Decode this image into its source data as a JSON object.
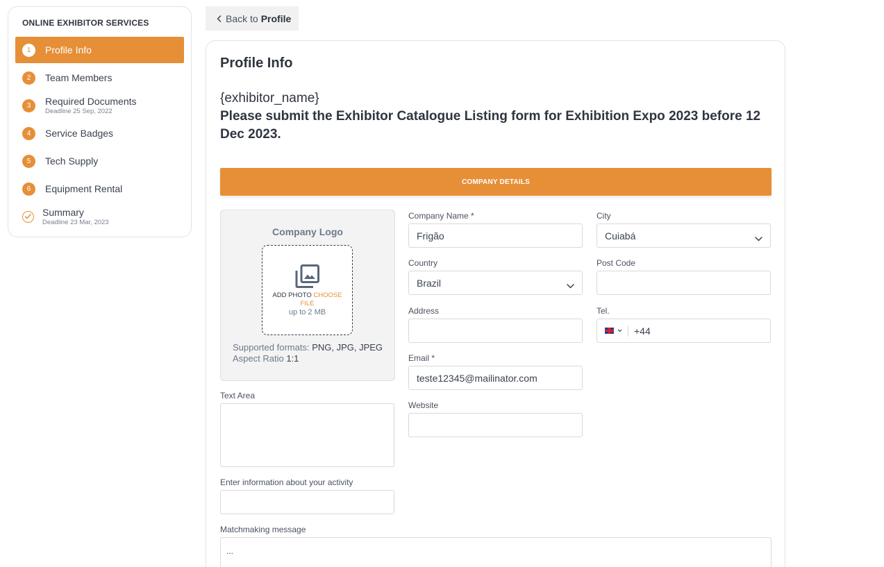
{
  "sidebar": {
    "title": "ONLINE EXHIBITOR SERVICES",
    "steps": [
      {
        "num": "1",
        "label": "Profile Info",
        "sub": ""
      },
      {
        "num": "2",
        "label": "Team Members",
        "sub": ""
      },
      {
        "num": "3",
        "label": "Required Documents",
        "sub": "Deadline 25 Sep, 2022"
      },
      {
        "num": "4",
        "label": "Service Badges",
        "sub": ""
      },
      {
        "num": "5",
        "label": "Tech Supply",
        "sub": ""
      },
      {
        "num": "6",
        "label": "Equipment Rental",
        "sub": ""
      },
      {
        "num": "",
        "label": "Summary",
        "sub": "Deadline 23 Mar, 2023"
      }
    ]
  },
  "back": {
    "prefix": "Back to",
    "target": "Profile"
  },
  "main": {
    "title": "Profile Info",
    "exhibitor_name": "{exhibitor_name}",
    "notice": "Please submit the Exhibitor Catalogue Listing form for Exhibition Expo 2023 before 12 Dec 2023.",
    "section": "COMPANY DETAILS"
  },
  "logo": {
    "title": "Company Logo",
    "add_photo": "ADD PHOTO",
    "choose_file": "CHOOSE FILE",
    "limit": "up to 2 MB",
    "formats_label": "Supported formats:",
    "formats_value": "PNG, JPG, JPEG",
    "ratio_label": "Aspect Ratio",
    "ratio_value": "1:1"
  },
  "form": {
    "company_name": {
      "label": "Company Name *",
      "value": "Frigão"
    },
    "city": {
      "label": "City",
      "value": "Cuiabá"
    },
    "country": {
      "label": "Country",
      "value": "Brazil"
    },
    "post_code": {
      "label": "Post Code",
      "value": ""
    },
    "address": {
      "label": "Address",
      "value": ""
    },
    "tel": {
      "label": "Tel.",
      "value": "+44"
    },
    "email": {
      "label": "Email *",
      "value": "teste12345@mailinator.com"
    },
    "website": {
      "label": "Website",
      "value": ""
    },
    "text_area": {
      "label": "Text Area",
      "value": ""
    },
    "activity": {
      "label": "Enter information about your activity",
      "value": ""
    },
    "matchmaking": {
      "label": "Matchmaking message",
      "value": "..."
    }
  },
  "colors": {
    "accent": "#e68f37",
    "text": "#2f3440",
    "border": "#d9d9d9"
  }
}
